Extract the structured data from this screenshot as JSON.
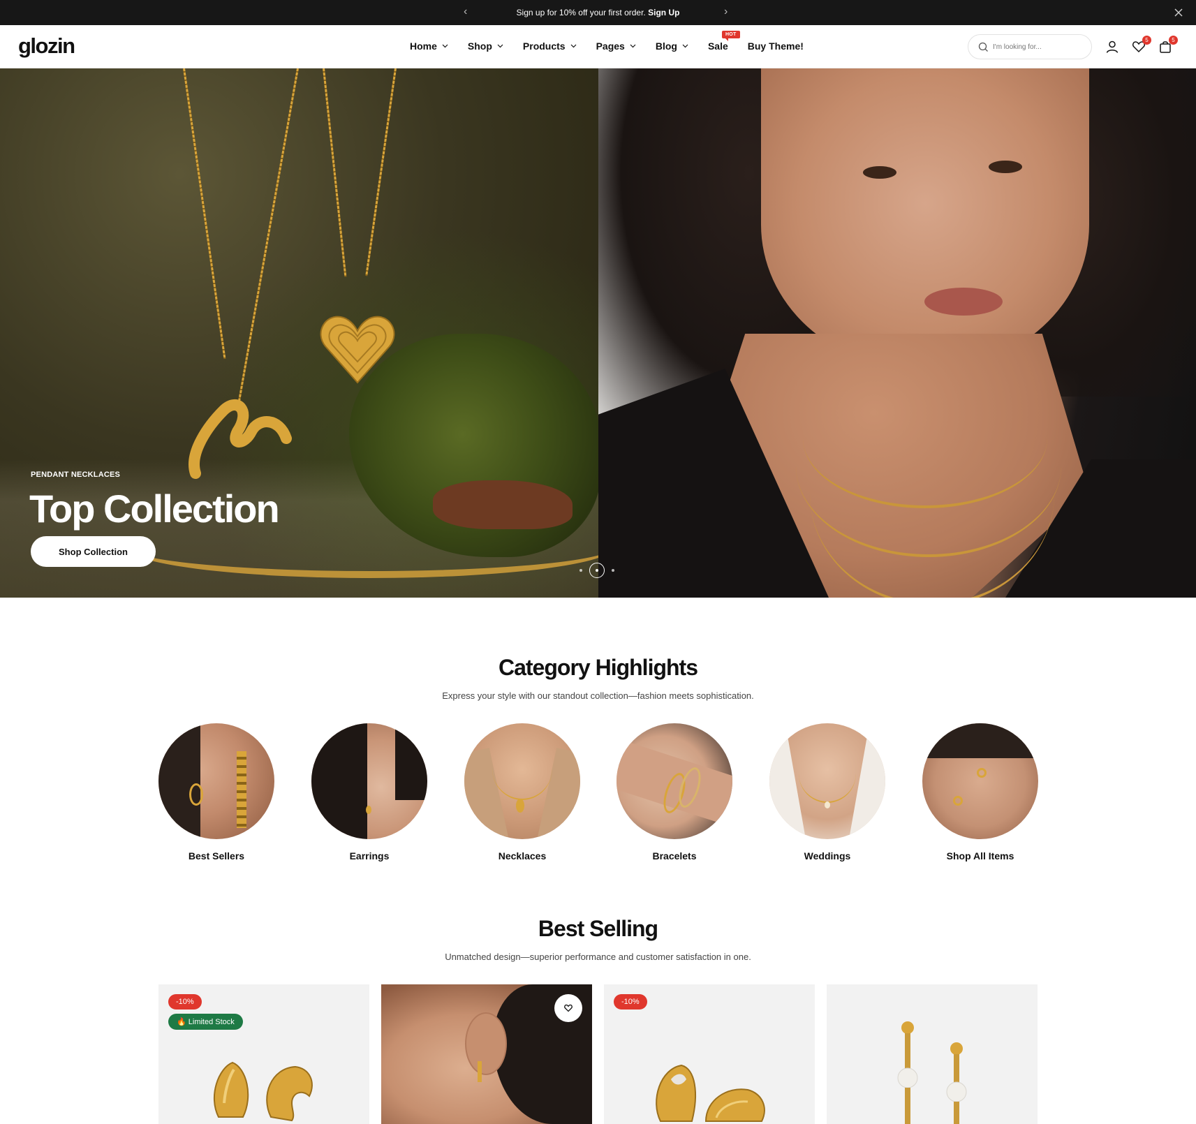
{
  "announcement": {
    "message": "Sign up for 10% off your first order.",
    "cta": "Sign Up"
  },
  "header": {
    "logo": "glozin",
    "nav": [
      {
        "label": "Home",
        "dropdown": true
      },
      {
        "label": "Shop",
        "dropdown": true
      },
      {
        "label": "Products",
        "dropdown": true
      },
      {
        "label": "Pages",
        "dropdown": true
      },
      {
        "label": "Blog",
        "dropdown": true
      },
      {
        "label": "Sale",
        "dropdown": false,
        "badge": "HOT"
      },
      {
        "label": "Buy Theme!",
        "dropdown": false
      }
    ],
    "search_placeholder": "I'm looking for...",
    "wishlist_count": "5",
    "cart_count": "5"
  },
  "hero": {
    "eyebrow": "PENDANT NECKLACES",
    "title": "Top Collection",
    "button": "Shop Collection",
    "slide_count": 3,
    "active_slide": 2
  },
  "categories": {
    "title": "Category Highlights",
    "subtitle": "Express your style with our standout collection—fashion meets sophistication.",
    "items": [
      {
        "label": "Best Sellers"
      },
      {
        "label": "Earrings"
      },
      {
        "label": "Necklaces"
      },
      {
        "label": "Bracelets"
      },
      {
        "label": "Weddings"
      },
      {
        "label": "Shop All Items"
      }
    ]
  },
  "best_selling": {
    "title": "Best Selling",
    "subtitle": "Unmatched design—superior performance and customer satisfaction in one.",
    "products": [
      {
        "sale_badge": "-10%",
        "stock_badge": "Limited Stock"
      },
      {
        "wishlist": true
      },
      {
        "sale_badge": "-10%"
      },
      {}
    ]
  },
  "colors": {
    "accent_red": "#e0372d",
    "stock_green": "#1e7a45",
    "dark": "#171717"
  }
}
